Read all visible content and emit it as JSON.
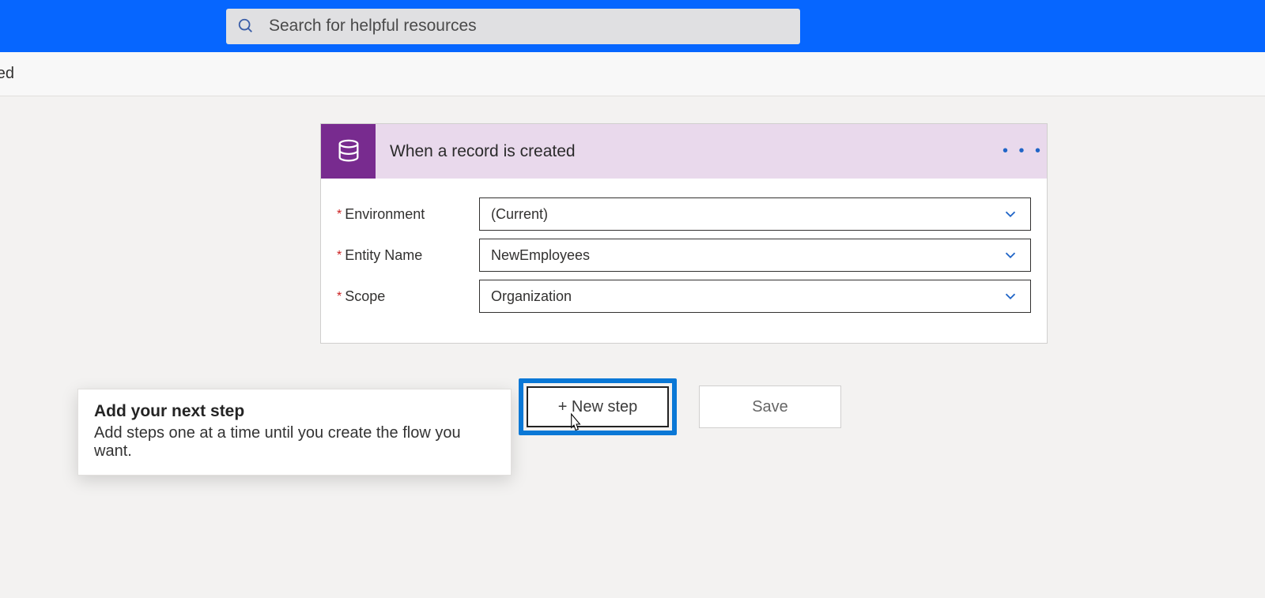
{
  "search": {
    "placeholder": "Search for helpful resources"
  },
  "subheader": {
    "text": "rded"
  },
  "trigger": {
    "title": "When a record is created",
    "fields": [
      {
        "label": "Environment",
        "value": "(Current)"
      },
      {
        "label": "Entity Name",
        "value": "NewEmployees"
      },
      {
        "label": "Scope",
        "value": "Organization"
      }
    ]
  },
  "tooltip": {
    "title": "Add your next step",
    "body": "Add steps one at a time until you create the flow you want."
  },
  "buttons": {
    "new_step": "+ New step",
    "save": "Save"
  },
  "glyphs": {
    "ellipsis": "• • •"
  }
}
